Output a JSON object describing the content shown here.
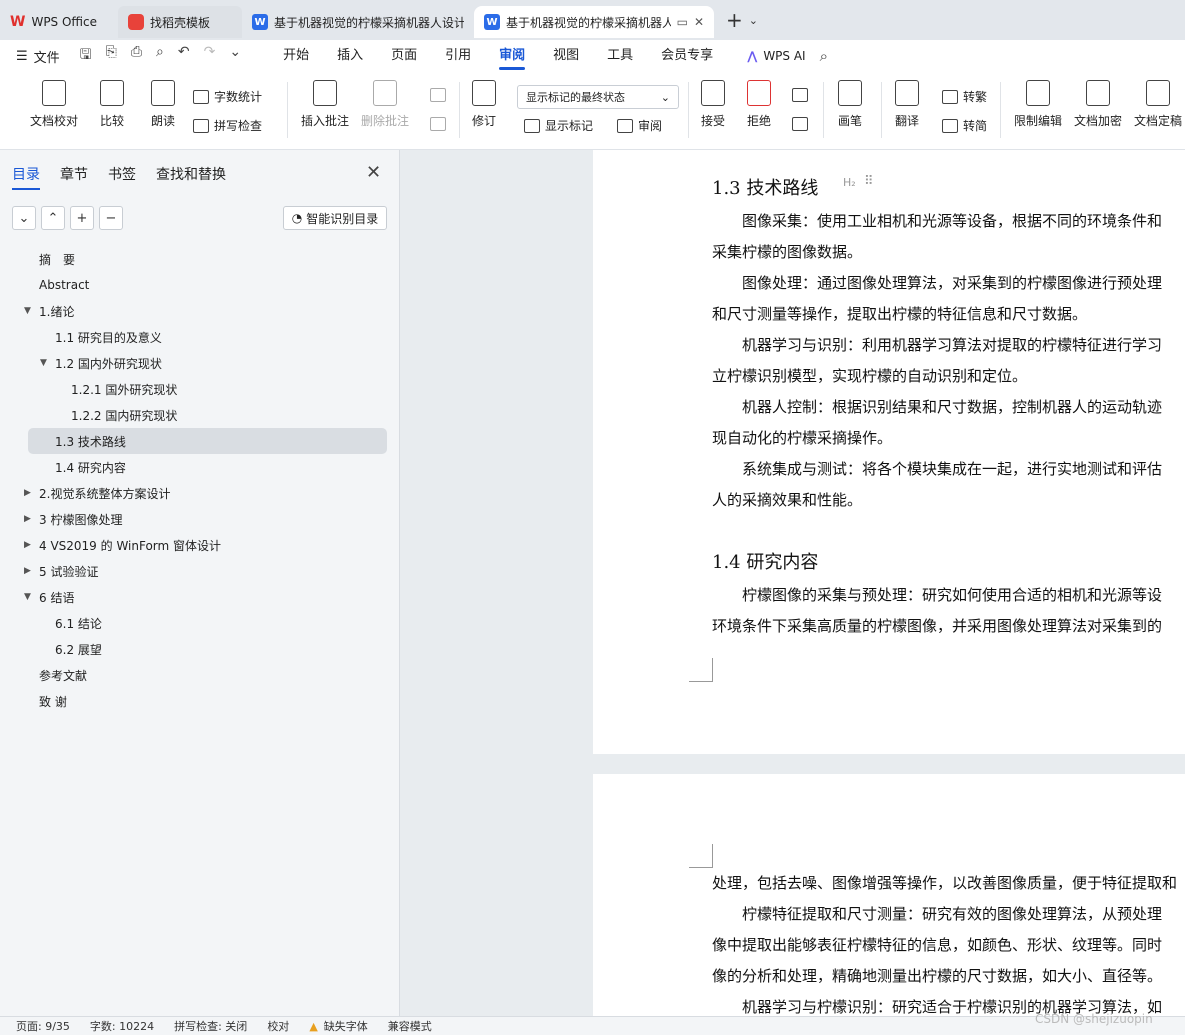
{
  "tabs": [
    {
      "title": "WPS Office"
    },
    {
      "title": "找稻壳模板"
    },
    {
      "title": "基于机器视觉的柠檬采摘机器人设计"
    },
    {
      "title": "基于机器视觉的柠檬采摘机器人"
    }
  ],
  "menubar": {
    "file": "文件",
    "tabs": [
      "开始",
      "插入",
      "页面",
      "引用",
      "审阅",
      "视图",
      "工具",
      "会员专享"
    ],
    "active_tab": "审阅",
    "ai": "WPS AI"
  },
  "ribbon": {
    "doc_check": "文档校对",
    "compare": "比较",
    "read_aloud": "朗读",
    "word_count": "字数统计",
    "spell_check": "拼写检查",
    "insert_comment": "插入批注",
    "delete_comment": "删除批注",
    "revise": "修订",
    "markup_select": "显示标记的最终状态",
    "show_markup": "显示标记",
    "review": "审阅",
    "accept": "接受",
    "reject": "拒绝",
    "pen": "画笔",
    "translate": "翻译",
    "to_traditional": "转繁",
    "to_simplified": "转简",
    "restrict_edit": "限制编辑",
    "encrypt": "文档加密",
    "finalize": "文档定稿"
  },
  "nav": {
    "tabs": [
      "目录",
      "章节",
      "书签",
      "查找和替换"
    ],
    "smart_toc": "智能识别目录",
    "toc": [
      {
        "label": "摘　要",
        "level": 1,
        "caret": ""
      },
      {
        "label": "Abstract",
        "level": 1,
        "caret": ""
      },
      {
        "label": "1.绪论",
        "level": 1,
        "caret": "down"
      },
      {
        "label": "1.1 研究目的及意义",
        "level": 2,
        "caret": ""
      },
      {
        "label": "1.2 国内外研究现状",
        "level": 2,
        "caret": "down"
      },
      {
        "label": "1.2.1 国外研究现状",
        "level": 3,
        "caret": ""
      },
      {
        "label": "1.2.2 国内研究现状",
        "level": 3,
        "caret": ""
      },
      {
        "label": "1.3  技术路线",
        "level": 2,
        "caret": "",
        "selected": true
      },
      {
        "label": "1.4  研究内容",
        "level": 2,
        "caret": ""
      },
      {
        "label": "2.视觉系统整体方案设计",
        "level": 1,
        "caret": "right"
      },
      {
        "label": "3  柠檬图像处理",
        "level": 1,
        "caret": "right"
      },
      {
        "label": "4 VS2019 的 WinForm 窗体设计",
        "level": 1,
        "caret": "right"
      },
      {
        "label": "5  试验验证",
        "level": 1,
        "caret": "right"
      },
      {
        "label": "6  结语",
        "level": 1,
        "caret": "down"
      },
      {
        "label": "6.1  结论",
        "level": 2,
        "caret": ""
      },
      {
        "label": "6.2  展望",
        "level": 2,
        "caret": ""
      },
      {
        "label": "参考文献",
        "level": 1,
        "caret": ""
      },
      {
        "label": "致  谢",
        "level": 1,
        "caret": ""
      }
    ]
  },
  "document": {
    "h2_marker": "H₂",
    "heading_13": "1.3  技术路线",
    "page1_lines": [
      "　　图像采集：使用工业相机和光源等设备，根据不同的环境条件和",
      "采集柠檬的图像数据。",
      "　　图像处理：通过图像处理算法，对采集到的柠檬图像进行预处理",
      "和尺寸测量等操作，提取出柠檬的特征信息和尺寸数据。",
      "　　机器学习与识别：利用机器学习算法对提取的柠檬特征进行学习",
      "立柠檬识别模型，实现柠檬的自动识别和定位。",
      "　　机器人控制：根据识别结果和尺寸数据，控制机器人的运动轨迹",
      "现自动化的柠檬采摘操作。",
      "　　系统集成与测试：将各个模块集成在一起，进行实地测试和评估",
      "人的采摘效果和性能。"
    ],
    "heading_14": "1.4  研究内容",
    "page1_lines_b": [
      "　　柠檬图像的采集与预处理：研究如何使用合适的相机和光源等设",
      "环境条件下采集高质量的柠檬图像，并采用图像处理算法对采集到的"
    ],
    "page2_lines": [
      "处理，包括去噪、图像增强等操作，以改善图像质量，便于特征提取和",
      "　　柠檬特征提取和尺寸测量：研究有效的图像处理算法，从预处理",
      "像中提取出能够表征柠檬特征的信息，如颜色、形状、纹理等。同时",
      "像的分析和处理，精确地测量出柠檬的尺寸数据，如大小、直径等。",
      "　　机器学习与柠檬识别：研究适合于柠檬识别的机器学习算法，如"
    ]
  },
  "status": {
    "page": "页面: 9/35",
    "words": "字数: 10224",
    "spell": "拼写检查: 关闭",
    "proof": "校对",
    "missing_font": "缺失字体",
    "compat": "兼容模式"
  },
  "watermark": "CSDN @shejizuopin"
}
